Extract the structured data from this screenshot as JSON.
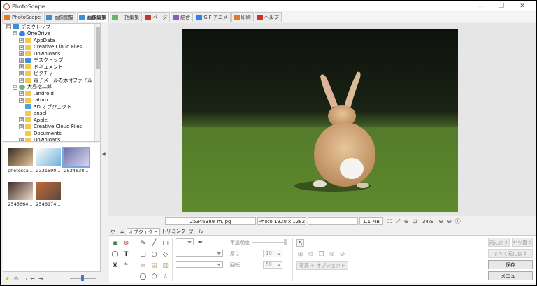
{
  "window": {
    "title": "PhotoScape",
    "minimize": "—",
    "maximize": "❐",
    "close": "✕"
  },
  "tabs": [
    {
      "label": "PhotoScape",
      "color": "#e07a2b"
    },
    {
      "label": "画像閲覧",
      "color": "#3a8fd8"
    },
    {
      "label": "画像編集",
      "color": "#3a8fd8"
    },
    {
      "label": "一括編集",
      "color": "#6bb36b"
    },
    {
      "label": "ページ",
      "color": "#c0392b"
    },
    {
      "label": "結合",
      "color": "#8e5bb5"
    },
    {
      "label": "GIF アニメ",
      "color": "#2f80ed"
    },
    {
      "label": "印刷",
      "color": "#e07a2b"
    },
    {
      "label": "ヘルプ",
      "color": "#d62d20"
    }
  ],
  "tree": [
    {
      "label": "デスクトップ",
      "level": 0,
      "toggle": "⊟",
      "icon": "desk"
    },
    {
      "label": "OneDrive",
      "level": 1,
      "toggle": "⊟",
      "icon": "cloud"
    },
    {
      "label": "AppData",
      "level": 2,
      "toggle": "⊞",
      "icon": "fold"
    },
    {
      "label": "Creative Cloud Files",
      "level": 2,
      "toggle": "⊞",
      "icon": "fold"
    },
    {
      "label": "Downloads",
      "level": 2,
      "toggle": "⊞",
      "icon": "fold"
    },
    {
      "label": "デスクトップ",
      "level": 2,
      "toggle": "⊞",
      "icon": "desk"
    },
    {
      "label": "ドキュメント",
      "level": 2,
      "toggle": "⊞",
      "icon": "fold"
    },
    {
      "label": "ピクチャ",
      "level": 2,
      "toggle": "⊞",
      "icon": "fold"
    },
    {
      "label": "電子メールの添付ファイル",
      "level": 2,
      "toggle": "⊞",
      "icon": "fold"
    },
    {
      "label": "大島松二郎",
      "level": 1,
      "toggle": "⊟",
      "icon": "user"
    },
    {
      "label": ".android",
      "level": 2,
      "toggle": "⊞",
      "icon": "fold"
    },
    {
      "label": ".atom",
      "level": 2,
      "toggle": "⊞",
      "icon": "fold"
    },
    {
      "label": "3D オブジェクト",
      "level": 2,
      "toggle": "",
      "icon": "obj"
    },
    {
      "label": "ansel",
      "level": 2,
      "toggle": "",
      "icon": "fold"
    },
    {
      "label": "Apple",
      "level": 2,
      "toggle": "⊞",
      "icon": "fold"
    },
    {
      "label": "Creative Cloud Files",
      "level": 2,
      "toggle": "⊞",
      "icon": "fold"
    },
    {
      "label": "Documents",
      "level": 2,
      "toggle": "",
      "icon": "fold"
    },
    {
      "label": "Downloads",
      "level": 2,
      "toggle": "⊞",
      "icon": "fold"
    }
  ],
  "thumbnails": [
    {
      "name": "photosca...",
      "selected": false,
      "colors": [
        "#3b2b20",
        "#e8c89a"
      ]
    },
    {
      "name": "2321590...",
      "selected": false,
      "colors": [
        "#ffffff",
        "#6ab0d8"
      ]
    },
    {
      "name": "2534638...",
      "selected": true,
      "colors": [
        "#6c6fa8",
        "#dcd8f0"
      ]
    },
    {
      "name": "2545664...",
      "selected": false,
      "colors": [
        "#3a2a24",
        "#f0d8c8"
      ]
    },
    {
      "name": "2546174...",
      "selected": false,
      "colors": [
        "#c46a3a",
        "#5a4a3a"
      ]
    }
  ],
  "status": {
    "filename": "25346389_m.jpg",
    "dimensions": "Photo 1920 x 1282",
    "filesize": "1.1 MB",
    "zoom": "34%"
  },
  "subtabs": [
    "ホーム",
    "オブジェクト",
    "トリミング",
    "ツール"
  ],
  "active_subtab": 1,
  "object_panel": {
    "opacity_label": "不透明度",
    "thickness_label": "厚さ",
    "thickness_value": "10",
    "rotation_label": "回転",
    "rotation_value": "50",
    "photo_object_button": "写真 + オブジェクト"
  },
  "actions": {
    "undo": "元に戻す",
    "redo": "やり直す",
    "undo_all": "すべて元に戻す",
    "save": "保存",
    "menu": "メニュー"
  }
}
